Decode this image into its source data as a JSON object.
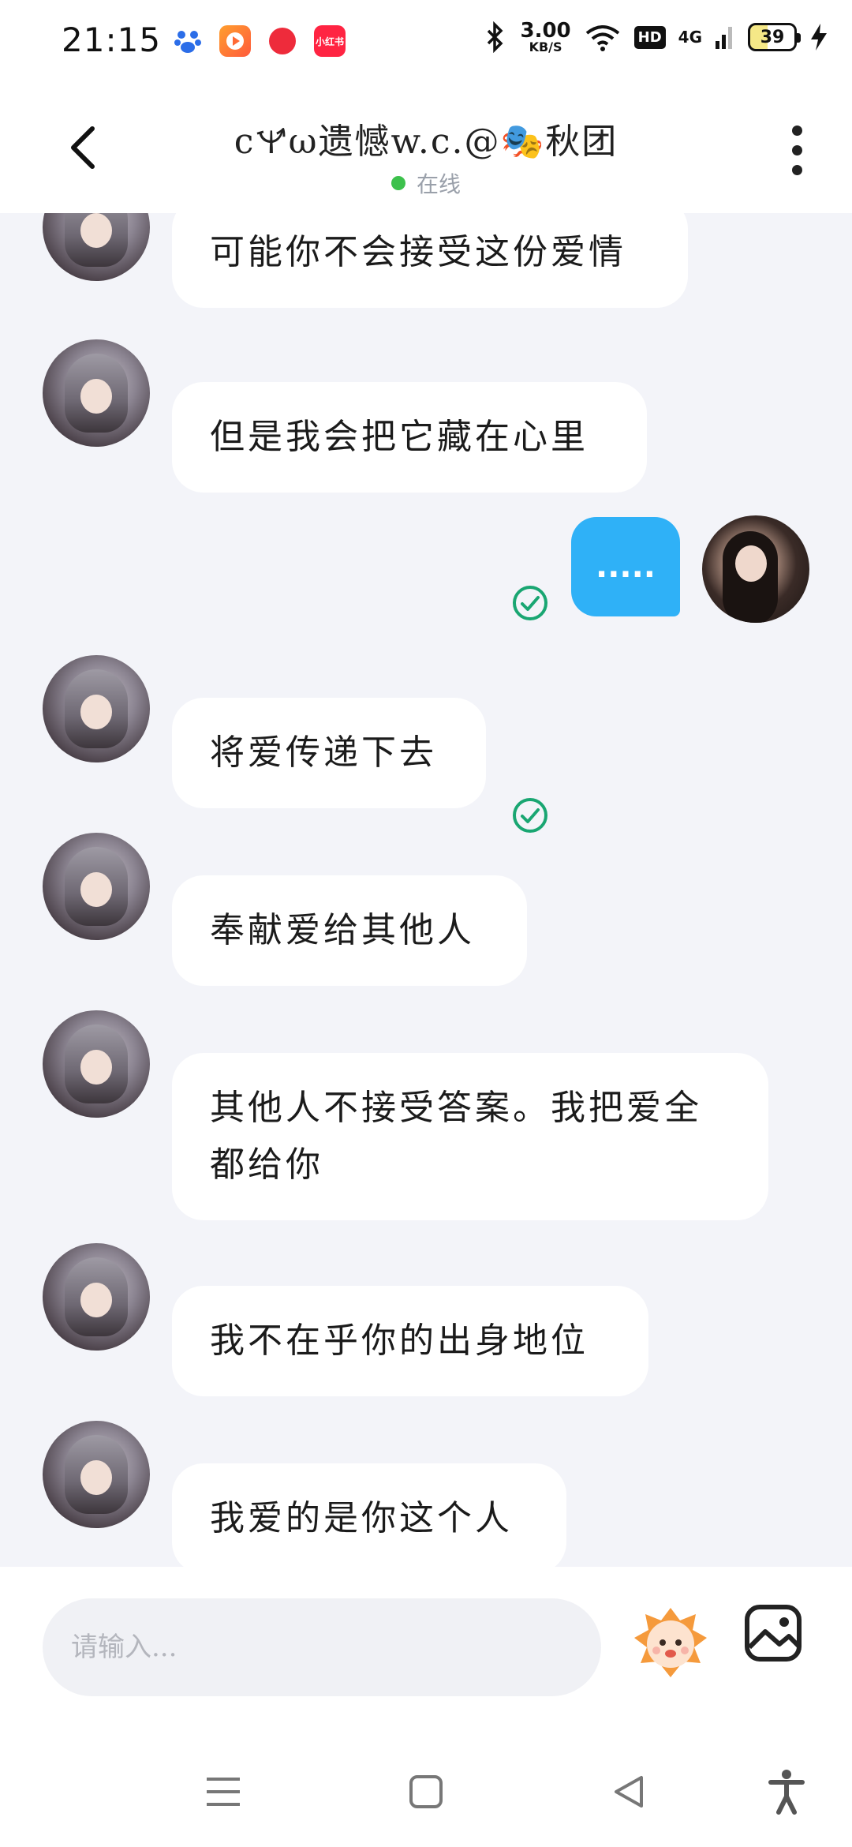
{
  "status_bar": {
    "time": "21:15",
    "net_speed_value": "3.00",
    "net_speed_unit": "KB/S",
    "hd_label": "HD",
    "network_label": "4G",
    "battery_level": "39",
    "icons": [
      "baidu-paw-icon",
      "video-app-icon",
      "record-app-icon",
      "xiaohongshu-icon",
      "bluetooth-icon",
      "wifi-icon",
      "charging-bolt-icon"
    ],
    "xhs_label": "小红书"
  },
  "header": {
    "back_icon": "chevron-left-icon",
    "title": "c🝤ω遗憾w.c.@🎭秋团",
    "online_label": "在线",
    "more_icon": "more-vertical-icon"
  },
  "messages": [
    {
      "side": "left",
      "text": "可能你不会接受这份爱情"
    },
    {
      "side": "left",
      "text": "但是我会把它藏在心里"
    },
    {
      "side": "right",
      "text": "....."
    },
    {
      "side": "left",
      "text": "将爱传递下去"
    },
    {
      "side": "left",
      "text": "奉献爱给其他人"
    },
    {
      "side": "left",
      "text": "其他人不接受答案。我把爱全都给你"
    },
    {
      "side": "left",
      "text": "我不在乎你的出身地位"
    },
    {
      "side": "left",
      "text": "我爱的是你这个人"
    }
  ],
  "composer": {
    "placeholder": "请输入...",
    "sticker_icon": "sticker-icon",
    "image_icon": "image-icon"
  },
  "navigation": {
    "icons": [
      "menu-icon",
      "home-square-icon",
      "back-triangle-icon",
      "accessibility-icon"
    ]
  },
  "colors": {
    "accent": "#2fb1f7",
    "online": "#3cc14c",
    "page_bg": "#f3f4f9"
  }
}
